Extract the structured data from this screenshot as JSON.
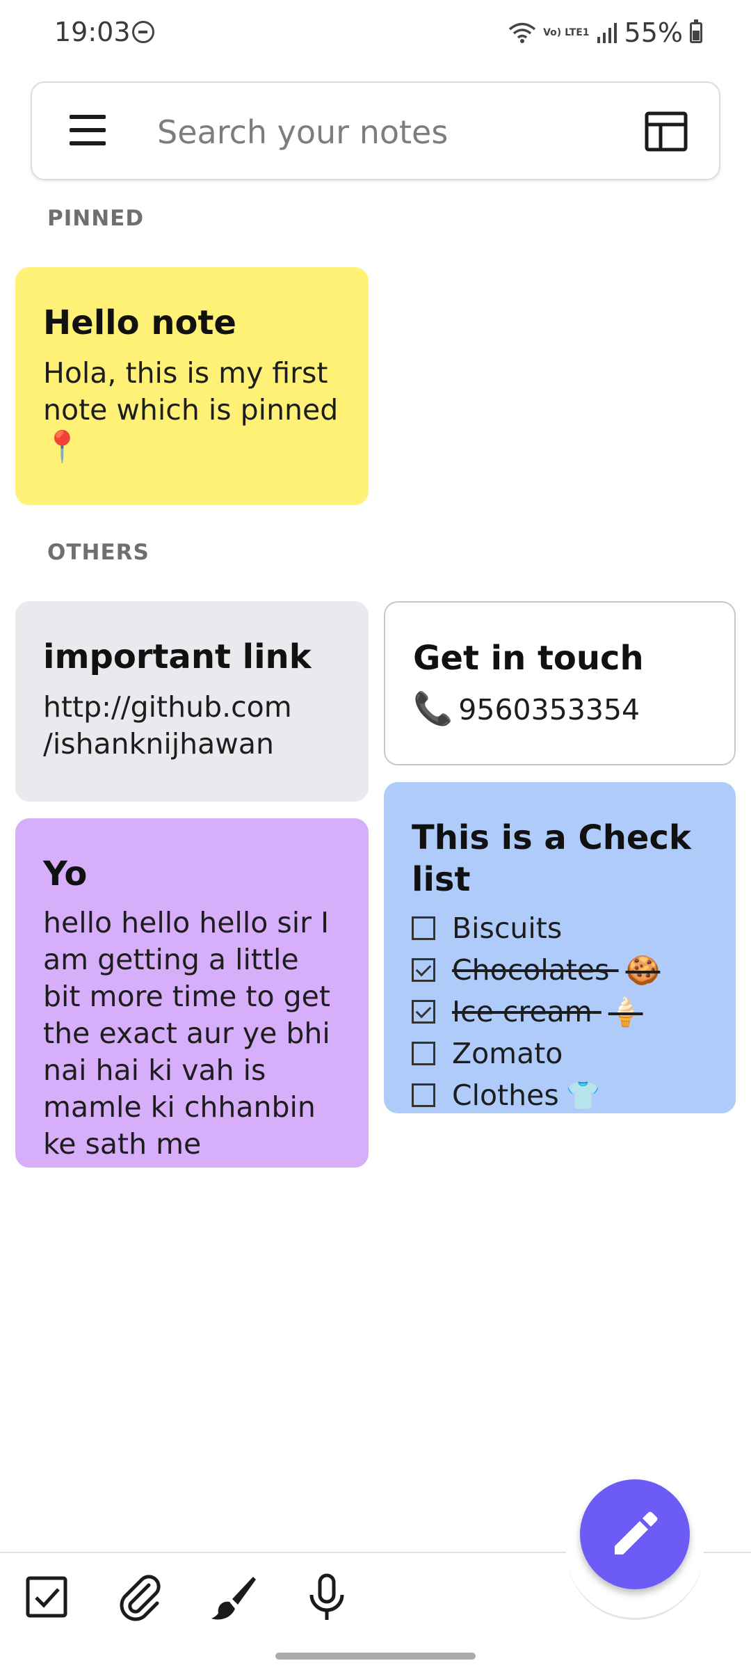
{
  "status_bar": {
    "time": "19:03",
    "network": "Vo) LTE1",
    "battery": "55%"
  },
  "search": {
    "placeholder": "Search your notes"
  },
  "sections": {
    "pinned": "PINNED",
    "others": "OTHERS"
  },
  "notes": {
    "hello": {
      "title": "Hello note",
      "body": "Hola, this is my first note which is pinned",
      "emoji": "📍",
      "color": "#fef176"
    },
    "link": {
      "title": "important link",
      "body_line1": "http://github.com",
      "body_line2": "/ishanknijhawan",
      "color": "#e8eaed"
    },
    "contact": {
      "title": "Get in touch",
      "icon": "📞",
      "phone": "9560353354",
      "color": "#ffffff"
    },
    "yo": {
      "title": "Yo",
      "body": "hello hello hello sir I am getting a little bit more time to get the exact aur ye bhi nai hai ki vah is mamle ki chhanbin ke sath me",
      "color": "#d6aefa"
    },
    "checklist": {
      "title": "This is a Check list",
      "color": "#aecbfa",
      "items": [
        {
          "text": "Biscuits",
          "checked": false,
          "emoji": ""
        },
        {
          "text": "Chocolates",
          "checked": true,
          "emoji": "🍪"
        },
        {
          "text": "Ice cream",
          "checked": true,
          "emoji": "🍦"
        },
        {
          "text": "Zomato",
          "checked": false,
          "emoji": ""
        },
        {
          "text": "Clothes",
          "checked": false,
          "emoji": "👕"
        }
      ]
    }
  },
  "fab": {
    "icon": "pencil-icon",
    "color": "#6c5cf5"
  },
  "bottom_bar": {
    "icons": [
      "checkbox-icon",
      "paperclip-icon",
      "brush-icon",
      "microphone-icon"
    ]
  }
}
